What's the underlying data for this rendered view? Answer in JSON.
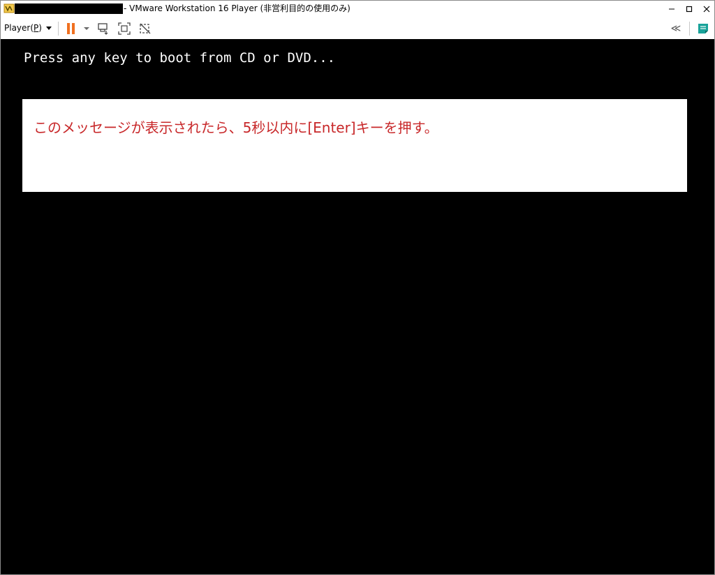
{
  "window": {
    "title": "- VMware Workstation 16 Player (非営利目的の使用のみ)",
    "minimize_glyph": "—",
    "maximize_glyph": "□",
    "close_glyph": "✕"
  },
  "toolbar": {
    "player_menu_label": "Player(",
    "player_menu_accel": "P",
    "player_menu_suffix": ")",
    "collapse_glyph": "≪",
    "icons": [
      "pause-icon",
      "send-ctrl-alt-del-icon",
      "full-screen-icon",
      "unity-icon",
      "collapse-icon",
      "notes-icon"
    ]
  },
  "vm": {
    "boot_message": "Press any key to boot from CD or DVD...",
    "annotation": "このメッセージが表示されたら、5秒以内に[Enter]キーを押す。"
  },
  "colors": {
    "pause_accent": "#f07020",
    "annotation_text": "#c8282a",
    "vm_background": "#000000",
    "notes_icon": "#1aa39a"
  }
}
